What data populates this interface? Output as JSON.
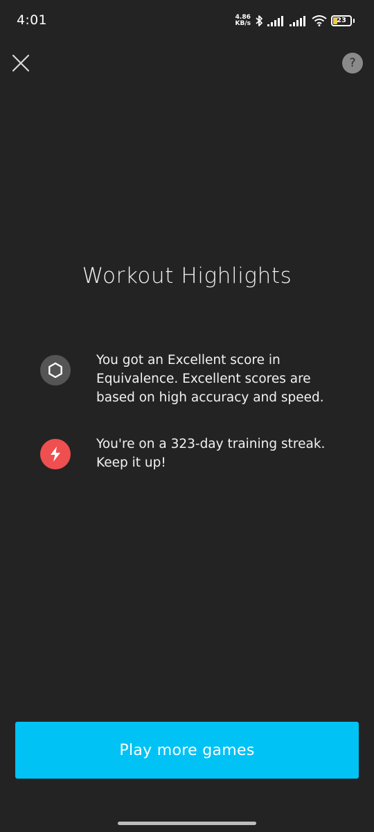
{
  "status_bar": {
    "time": "4:01",
    "net_speed_value": "4.86",
    "net_speed_unit": "KB/s",
    "battery_level": "23",
    "battery_fraction": 0.23,
    "battery_color": "#f2c94c"
  },
  "header": {
    "help_label": "?"
  },
  "title": "Workout Highlights",
  "highlights": [
    {
      "icon": "hexagon-icon",
      "text": "You got an Excellent score in Equivalence. Excellent scores are based on high accuracy and speed."
    },
    {
      "icon": "lightning-bolt-icon",
      "text": "You're on a 323-day training streak. Keep it up!"
    }
  ],
  "primary_button": {
    "label": "Play more games",
    "color": "#00c2f4"
  },
  "colors": {
    "background": "#232323",
    "streak_icon_bg": "#f04f4f",
    "score_icon_bg": "#555555"
  }
}
